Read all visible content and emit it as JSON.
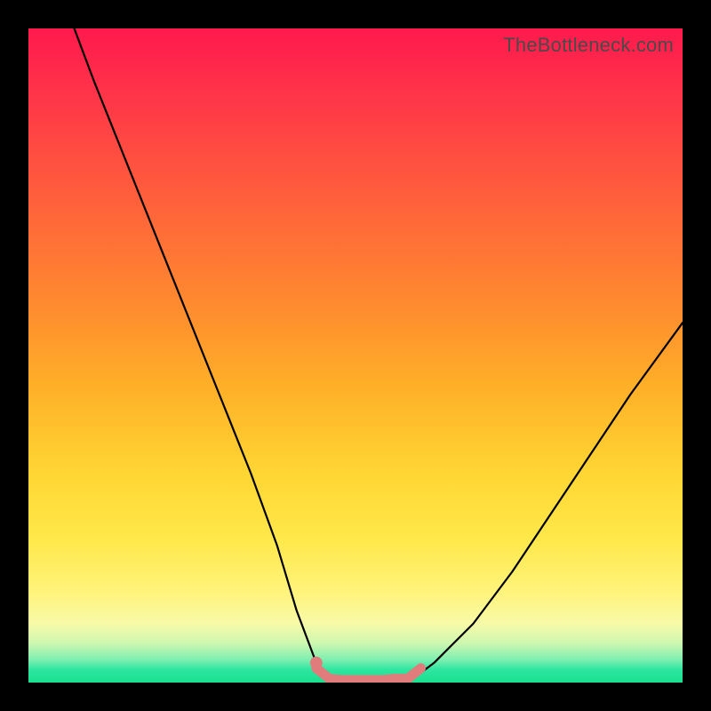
{
  "watermark": "TheBottleneck.com",
  "chart_data": {
    "type": "line",
    "title": "",
    "xlabel": "",
    "ylabel": "",
    "xlim": [
      0,
      100
    ],
    "ylim": [
      0,
      100
    ],
    "series": [
      {
        "name": "left-curve",
        "x": [
          7,
          10,
          14,
          18,
          22,
          26,
          30,
          34,
          38,
          41,
          44,
          46
        ],
        "y": [
          100,
          92,
          82,
          72,
          62,
          52,
          42,
          32,
          21,
          11,
          3,
          0
        ]
      },
      {
        "name": "right-curve",
        "x": [
          58,
          62,
          68,
          74,
          80,
          86,
          92,
          100
        ],
        "y": [
          0,
          3,
          9,
          17,
          26,
          35,
          44,
          55
        ]
      },
      {
        "name": "bottom-segment",
        "x": [
          44,
          46,
          48,
          50,
          52,
          54,
          56,
          58,
          60
        ],
        "y": [
          2.2,
          0.6,
          0.4,
          0.4,
          0.4,
          0.4,
          0.6,
          0.6,
          2.2
        ]
      }
    ],
    "annotations": [],
    "colors": {
      "curve": "#000000",
      "bottom_segment": "#e07c7c",
      "bottom_marker": "#e07c7c"
    }
  }
}
